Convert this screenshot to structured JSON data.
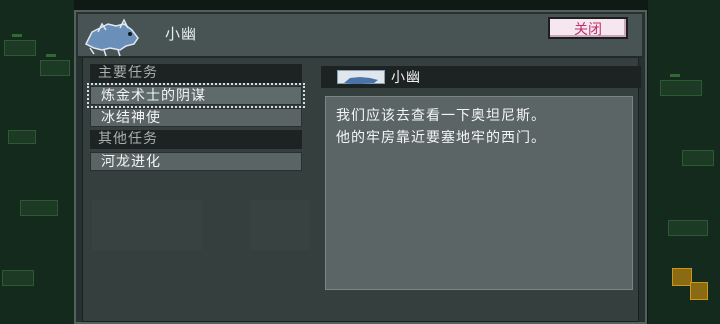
{
  "header": {
    "npc_name": "小幽",
    "close_label": "关闭"
  },
  "quests": {
    "main_section_label": "主要任务",
    "main_items": [
      {
        "label": "炼金术士的阴谋",
        "selected": true
      },
      {
        "label": "冰结神使",
        "selected": false
      }
    ],
    "other_section_label": "其他任务",
    "other_items": [
      {
        "label": "河龙进化",
        "selected": false
      }
    ]
  },
  "detail": {
    "npc_name": "小幽",
    "lines": [
      "我们应该去查看一下奥坦尼斯。",
      "他的牢房靠近要塞地牢的西门。"
    ]
  },
  "colors": {
    "close_text": "#c0306a",
    "panel_bg": "#35403e",
    "portrait_fill": "#6a8fb8"
  },
  "icons": {
    "portrait": "spirit-creature-icon",
    "detail": "spirit-creature-icon"
  }
}
